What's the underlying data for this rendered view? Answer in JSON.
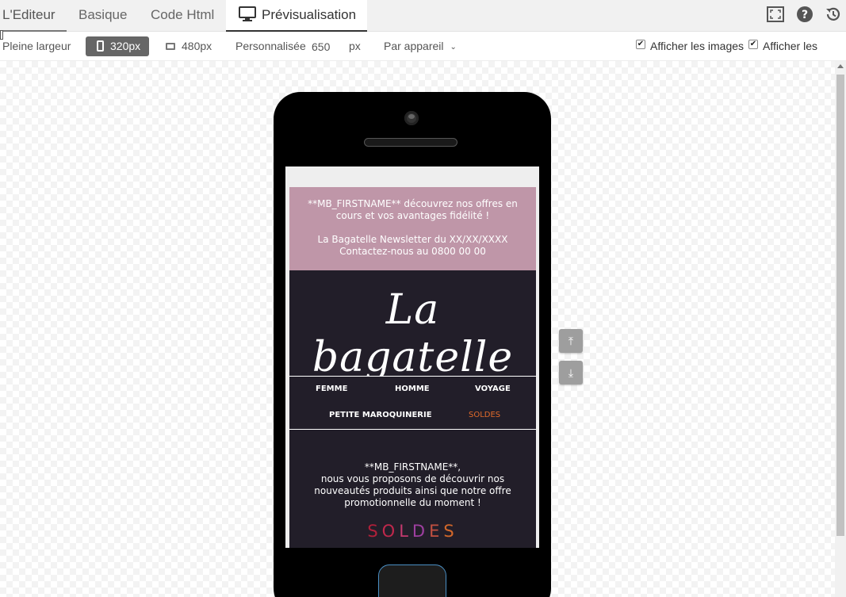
{
  "tabs": {
    "editeur": "L'Editeur",
    "basique": "Basique",
    "code_html": "Code Html",
    "previsualisation": "Prévisualisation"
  },
  "top_icons": [
    "fullscreen-icon",
    "help-icon",
    "history-icon"
  ],
  "toolbar": {
    "full_width": "Pleine largeur",
    "size_320": "320px",
    "size_480": "480px",
    "custom_label": "Personnalisée",
    "custom_width_value": "650",
    "custom_unit": "px",
    "by_device": "Par appareil",
    "show_images": "Afficher les images",
    "show_codes": "Afficher les codes",
    "show_images_checked": true,
    "show_codes_checked": true,
    "selected_size": "320px"
  },
  "email": {
    "header_line1": "**MB_FIRSTNAME** découvrez nos offres en cours et vos avantages fidélité !",
    "header_line2": "La Bagatelle Newsletter du XX/XX/XXXX",
    "header_line3": "Contactez-nous au 0800 00 00",
    "logo": "La bagatelle",
    "nav": {
      "femme": "FEMME",
      "homme": "HOMME",
      "voyage": "VOYAGE",
      "petite_maroquinerie": "PETITE MAROQUINERIE",
      "soldes": "SOLDES"
    },
    "body_greeting": "**MB_FIRSTNAME**,",
    "body_text": "nous vous proposons de découvrir nos nouveautés produits ainsi que notre offre promotionnelle du moment !",
    "soldes_letters": [
      "S",
      "O",
      "L",
      "D",
      "E",
      "S"
    ],
    "soldes_colors": [
      "#b0203a",
      "#c0284c",
      "#c43a6e",
      "#9e3fa0",
      "#c25040",
      "#d2672a"
    ]
  },
  "side_buttons": [
    "scroll-top-icon",
    "scroll-bottom-icon"
  ],
  "colors": {
    "header_pink": "#bf96a8",
    "dark_bg": "#221e29",
    "soldes_nav": "#e06a2a",
    "selected_button": "#666666"
  }
}
